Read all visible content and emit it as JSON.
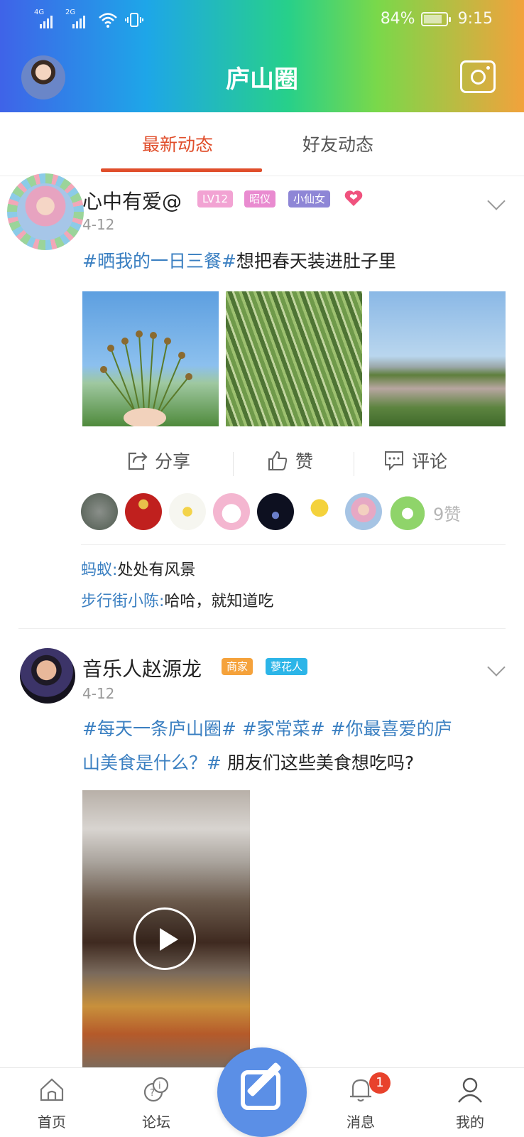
{
  "status_bar": {
    "sim1": "4G",
    "sim2": "2G",
    "battery_percent": "84%",
    "time": "9:15",
    "battery_level": 0.84
  },
  "header": {
    "title": "庐山圈",
    "camera_icon": "camera-icon",
    "avatar_icon": "user-avatar"
  },
  "tabs": [
    {
      "label": "最新动态",
      "active": true
    },
    {
      "label": "好友动态",
      "active": false
    }
  ],
  "posts": [
    {
      "author": "心中有爱@",
      "badges": [
        {
          "text": "LV12",
          "color": "#f2a3d3"
        },
        {
          "text": "昭仪",
          "color": "#e98bd0"
        },
        {
          "text": "小仙女",
          "color": "#8e86d6"
        }
      ],
      "date": "4-12",
      "text_tag": "#晒我的一日三餐#",
      "text_body": "想把春天装进肚子里",
      "actions": {
        "share": "分享",
        "like": "赞",
        "comment": "评论"
      },
      "like_count": "9赞",
      "comments": [
        {
          "user": "蚂蚁:",
          "text": "处处有风景"
        },
        {
          "user": "步行街小陈:",
          "text": "哈哈，就知道吃"
        }
      ]
    },
    {
      "author": "音乐人赵源龙",
      "badges": [
        {
          "text": "商家",
          "color": "#f5a23b"
        },
        {
          "text": "蓼花人",
          "color": "#2cb5e8"
        }
      ],
      "date": "4-12",
      "line1_tags": "#每天一条庐山圈# #家常菜# #你最喜爱的庐",
      "line2_tags": "山美食是什么？#",
      "line2_body": " 朋友们这些美食想吃吗?"
    }
  ],
  "bottom_nav": {
    "home": "首页",
    "forum": "论坛",
    "messages": "消息",
    "mine": "我的",
    "message_badge": "1"
  },
  "colors": {
    "accent": "#e04e2b",
    "tag": "#3a7fc1",
    "fab": "#5b8fe6"
  }
}
